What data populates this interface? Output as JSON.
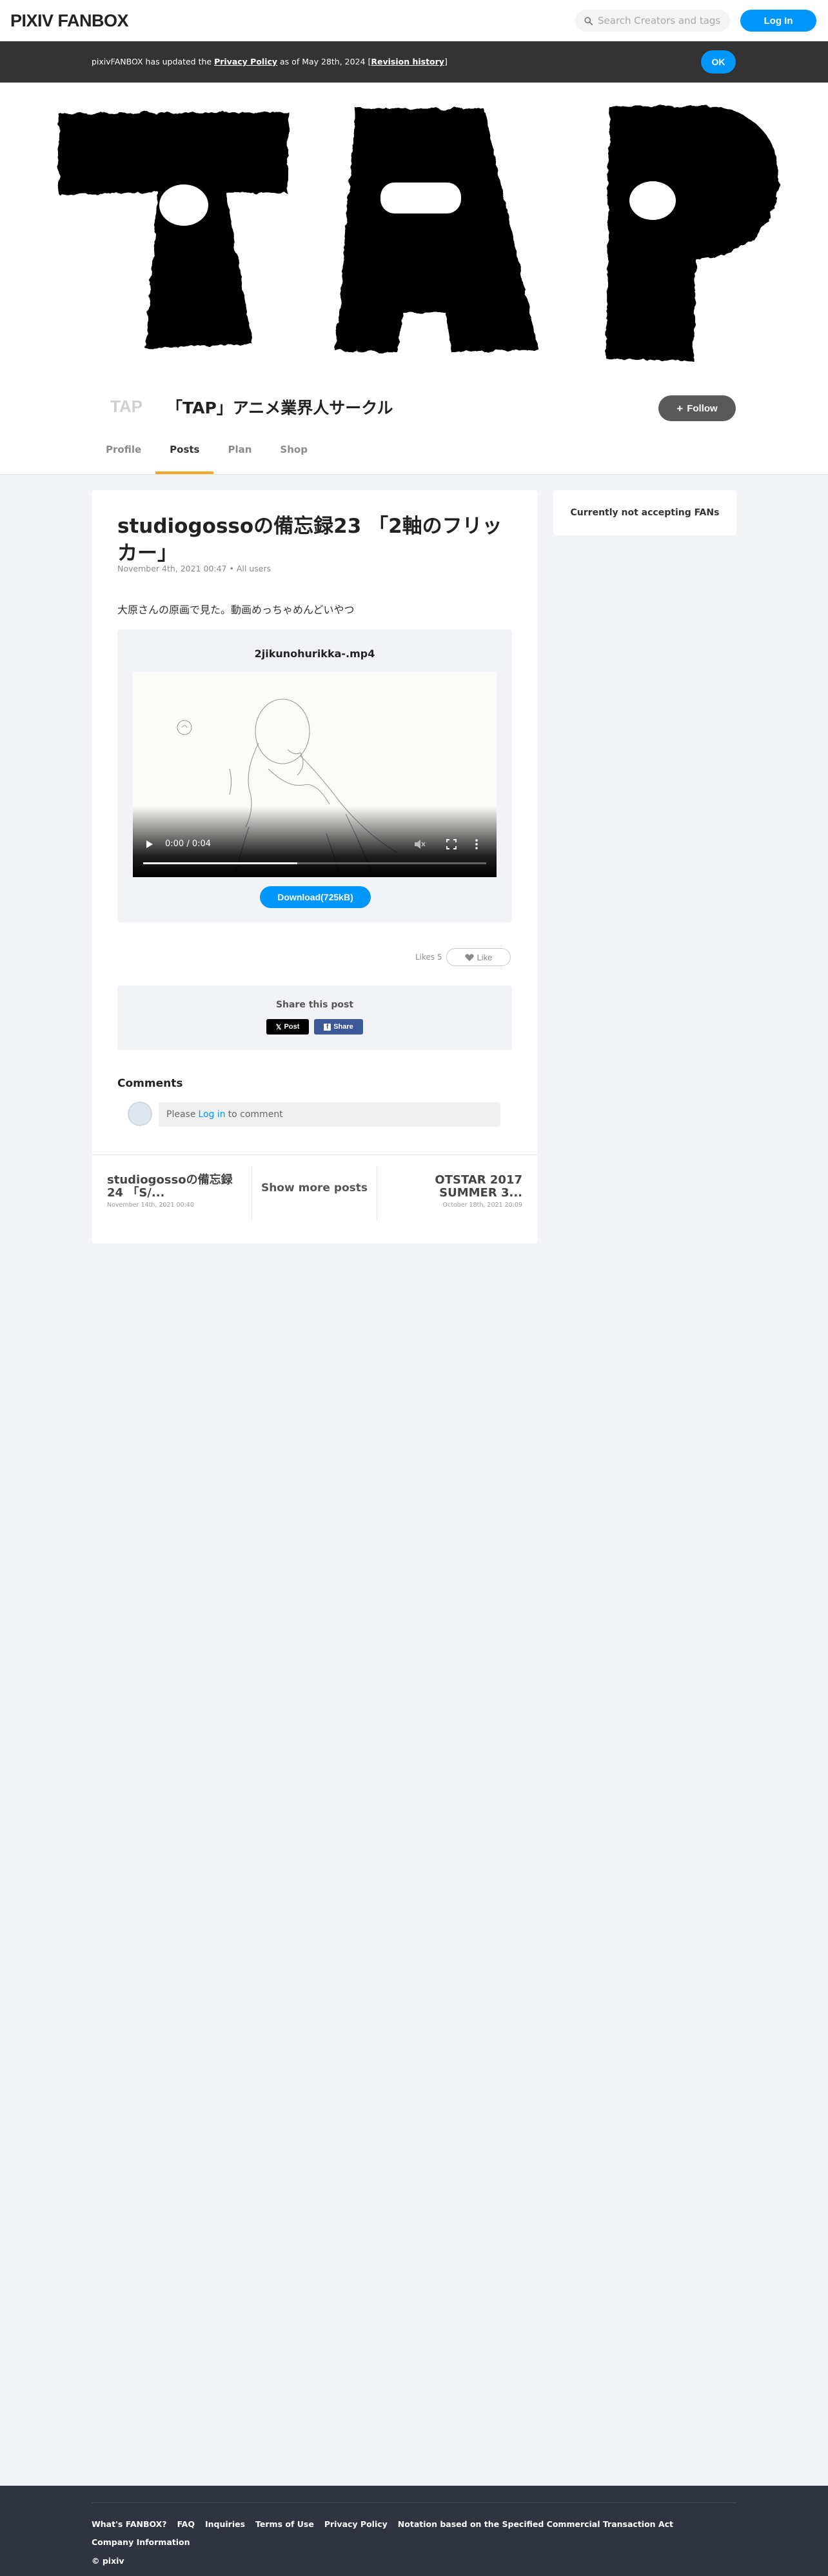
{
  "header": {
    "logo": "PIXIV FANBOX",
    "search_placeholder": "Search Creators and tags",
    "login_label": "Log In"
  },
  "notice": {
    "prefix": "pixivFANBOX has updated the ",
    "policy_link": "Privacy Policy",
    "middle": " as of May 28th, 2024 [",
    "history_link": "Revision history",
    "suffix": "]",
    "ok_label": "OK"
  },
  "cover": {
    "text": "TAP"
  },
  "creator": {
    "name": "「TAP」アニメ業界人サークル",
    "avatar_text": "TAP",
    "follow_label": "Follow"
  },
  "tabs": [
    {
      "label": "Profile",
      "active": false
    },
    {
      "label": "Posts",
      "active": true
    },
    {
      "label": "Plan",
      "active": false
    },
    {
      "label": "Shop",
      "active": false
    }
  ],
  "post": {
    "title": "studiogossoの備忘録23 「2軸のフリッカー」",
    "meta": "November 4th, 2021 00:47 • All users",
    "body": "大原さんの原画で見た。動画めっちゃめんどいやつ",
    "file_name": "2jikunohurikka-.mp4",
    "video_time": "0:00 / 0:04",
    "video_progress": 0.45,
    "download_label": "Download(725kB)",
    "likes_label": "Likes 5",
    "like_button": "Like",
    "share_title": "Share this post",
    "share_x_label": "Post",
    "share_fb_label": "Share",
    "comments_title": "Comments",
    "comment_prefix": "Please",
    "comment_login": "Log in",
    "comment_suffix": "to comment"
  },
  "navigation": {
    "prev_title": "studiogossoの備忘録24 「S/...",
    "prev_date": "November 14th, 2021 00:40",
    "show_more": "Show more posts",
    "next_title": "OTSTAR 2017 SUMMER 3...",
    "next_date": "October 18th, 2021 20:09"
  },
  "side": {
    "fans_status": "Currently not accepting FANs"
  },
  "footer": {
    "links": [
      "What's FANBOX?",
      "FAQ",
      "Inquiries",
      "Terms of Use",
      "Privacy Policy",
      "Notation based on the Specified Commercial Transaction Act",
      "Company Information"
    ],
    "copyright": "© pixiv"
  },
  "colors": {
    "accent": "#0096fa",
    "tab_underline": "#f5a623",
    "notice_bg": "#333333",
    "footer_bg": "#2f3440",
    "page_bg": "#f2f3f7"
  }
}
